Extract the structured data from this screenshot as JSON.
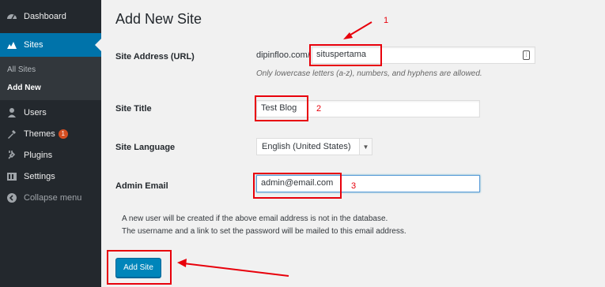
{
  "sidebar": {
    "items": [
      {
        "label": "Dashboard",
        "icon": "dashboard-icon"
      },
      {
        "label": "Sites",
        "icon": "sites-icon"
      },
      {
        "label": "Users",
        "icon": "users-icon"
      },
      {
        "label": "Themes",
        "icon": "themes-icon",
        "badge": "1"
      },
      {
        "label": "Plugins",
        "icon": "plugins-icon"
      },
      {
        "label": "Settings",
        "icon": "settings-icon"
      },
      {
        "label": "Collapse menu",
        "icon": "collapse-icon"
      }
    ],
    "submenu": [
      "All Sites",
      "Add New"
    ]
  },
  "page": {
    "title": "Add New Site",
    "site_address_label": "Site Address (URL)",
    "domain": "dipinfloo.com/",
    "site_address_value": "situspertama",
    "site_address_help": "Only lowercase letters (a-z), numbers, and hyphens are allowed.",
    "site_title_label": "Site Title",
    "site_title_value": "Test Blog",
    "site_language_label": "Site Language",
    "site_language_value": "English (United States)",
    "admin_email_label": "Admin Email",
    "admin_email_value": "admin@email.com",
    "note_line1": "A new user will be created if the above email address is not in the database.",
    "note_line2": "The username and a link to set the password will be mailed to this email address.",
    "submit_label": "Add Site"
  },
  "annotations": {
    "n1": "1",
    "n2": "2",
    "n3": "3",
    "color": "#e8000b"
  },
  "colors": {
    "sidebar_bg": "#23282d",
    "active_bg": "#0073aa",
    "button_bg": "#0085ba"
  }
}
